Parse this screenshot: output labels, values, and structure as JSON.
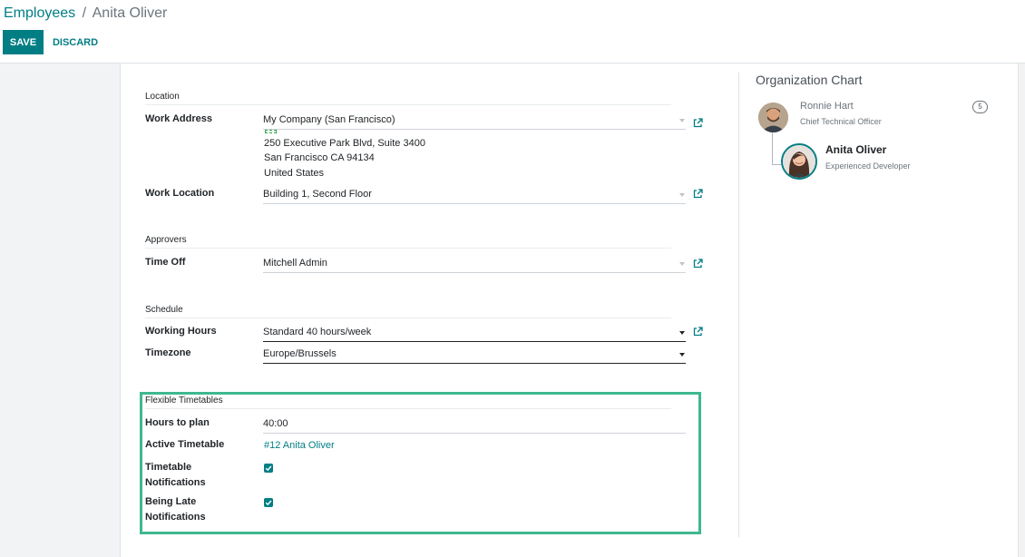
{
  "breadcrumb": {
    "parent": "Employees",
    "separator": "/",
    "current": "Anita Oliver"
  },
  "toolbar": {
    "save_label": "SAVE",
    "discard_label": "DISCARD"
  },
  "location": {
    "title": "Location",
    "work_address_label": "Work Address",
    "work_address_value": "My Company (San Francisco)",
    "address_lines": [
      "250 Executive Park Blvd, Suite 3400",
      "San Francisco CA 94134",
      "United States"
    ],
    "work_location_label": "Work Location",
    "work_location_value": "Building 1, Second Floor"
  },
  "approvers": {
    "title": "Approvers",
    "time_off_label": "Time Off",
    "time_off_value": "Mitchell Admin"
  },
  "schedule": {
    "title": "Schedule",
    "working_hours_label": "Working Hours",
    "working_hours_value": "Standard 40 hours/week",
    "timezone_label": "Timezone",
    "timezone_value": "Europe/Brussels"
  },
  "flexible": {
    "title": "Flexible Timetables",
    "hours_to_plan_label": "Hours to plan",
    "hours_to_plan_value": "40:00",
    "active_timetable_label": "Active Timetable",
    "active_timetable_value": "#12 Anita Oliver",
    "timetable_notifications_label_1": "Timetable",
    "timetable_notifications_label_2": "Notifications",
    "timetable_notifications_checked": true,
    "being_late_label_1": "Being Late",
    "being_late_label_2": "Notifications",
    "being_late_checked": true
  },
  "org_chart": {
    "title": "Organization Chart",
    "manager_name": "Ronnie Hart",
    "manager_job": "Chief Technical Officer",
    "manager_count": "5",
    "employee_name": "Anita Oliver",
    "employee_job": "Experienced Developer"
  },
  "colors": {
    "primary": "#017e84",
    "highlight": "#3fb890"
  }
}
